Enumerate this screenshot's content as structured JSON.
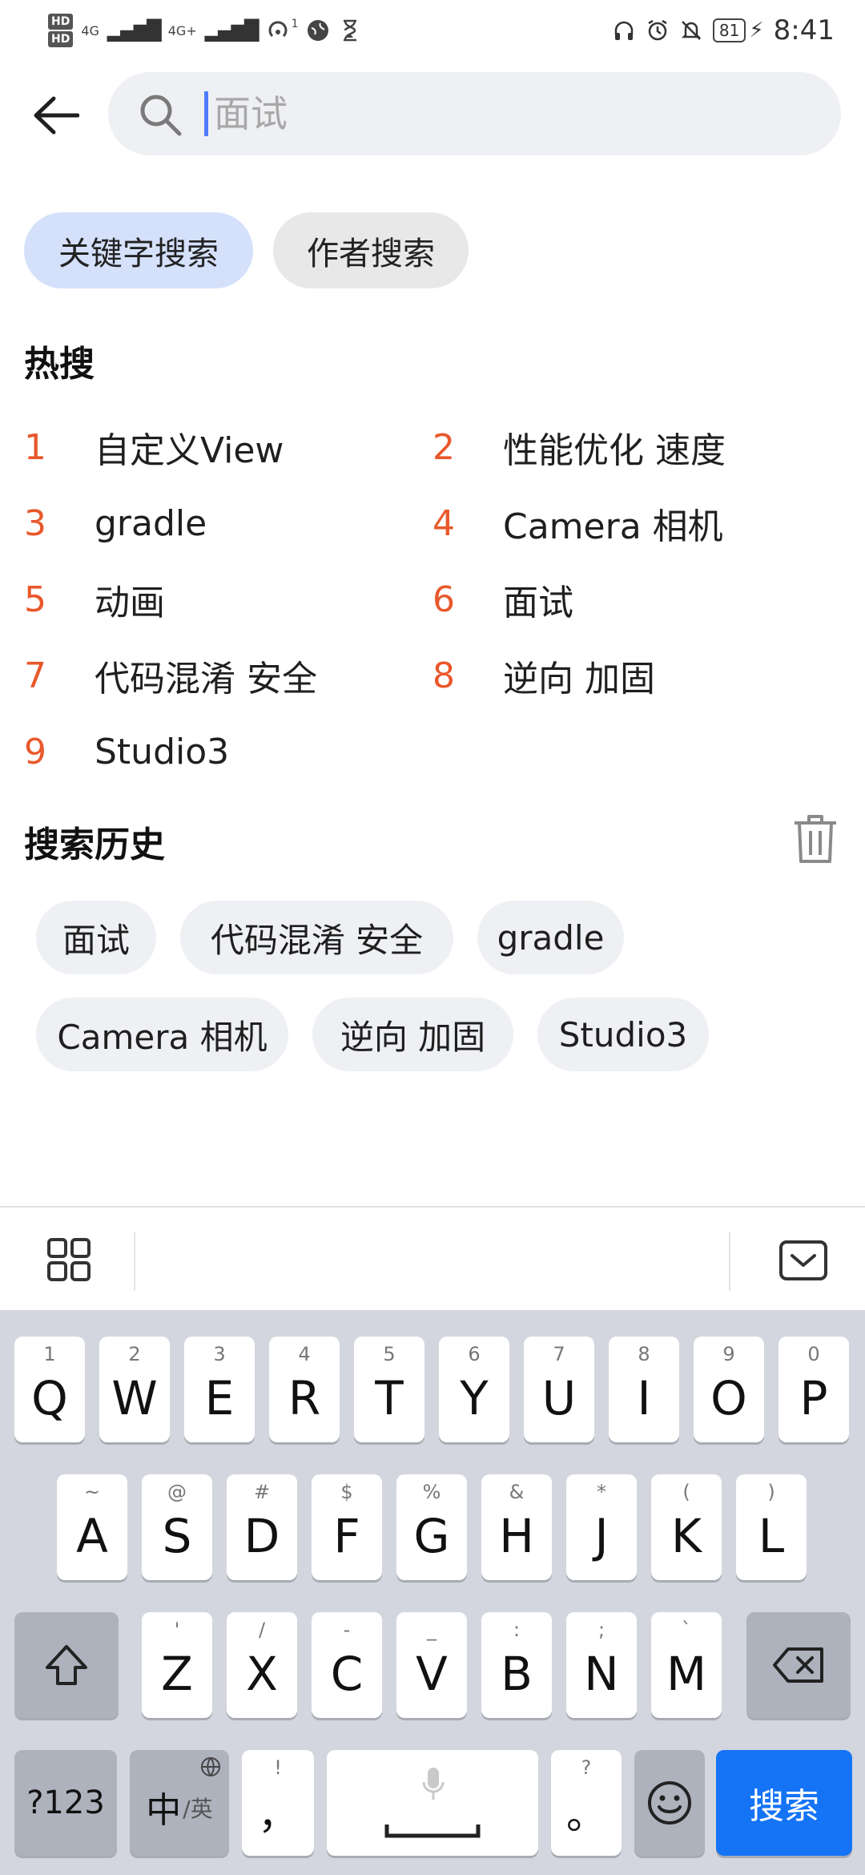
{
  "status_bar": {
    "left": {
      "hd1": "HD",
      "hd2": "HD",
      "net1": "4G",
      "net2": "4G+",
      "sup": "1"
    },
    "battery": "81",
    "time": "8:41"
  },
  "search": {
    "placeholder": "面试",
    "caret_color": "#4f7cff"
  },
  "tabs": [
    {
      "label": "关键字搜索",
      "active": true
    },
    {
      "label": "作者搜索",
      "active": false
    }
  ],
  "hot": {
    "title": "热搜",
    "items": [
      {
        "num": "1",
        "text": "自定义View"
      },
      {
        "num": "2",
        "text": "性能优化 速度"
      },
      {
        "num": "3",
        "text": "gradle"
      },
      {
        "num": "4",
        "text": "Camera 相机"
      },
      {
        "num": "5",
        "text": "动画"
      },
      {
        "num": "6",
        "text": "面试"
      },
      {
        "num": "7",
        "text": "代码混淆 安全"
      },
      {
        "num": "8",
        "text": "逆向 加固"
      },
      {
        "num": "9",
        "text": "Studio3"
      }
    ]
  },
  "history": {
    "title": "搜索历史",
    "chips": [
      "面试",
      "代码混淆 安全",
      "gradle",
      "Camera 相机",
      "逆向 加固",
      "Studio3"
    ]
  },
  "keyboard": {
    "row1": [
      {
        "hint": "1",
        "key": "Q"
      },
      {
        "hint": "2",
        "key": "W"
      },
      {
        "hint": "3",
        "key": "E"
      },
      {
        "hint": "4",
        "key": "R"
      },
      {
        "hint": "5",
        "key": "T"
      },
      {
        "hint": "6",
        "key": "Y"
      },
      {
        "hint": "7",
        "key": "U"
      },
      {
        "hint": "8",
        "key": "I"
      },
      {
        "hint": "9",
        "key": "O"
      },
      {
        "hint": "0",
        "key": "P"
      }
    ],
    "row2": [
      {
        "hint": "~",
        "key": "A"
      },
      {
        "hint": "@",
        "key": "S"
      },
      {
        "hint": "#",
        "key": "D"
      },
      {
        "hint": "$",
        "key": "F"
      },
      {
        "hint": "%",
        "key": "G"
      },
      {
        "hint": "&",
        "key": "H"
      },
      {
        "hint": "*",
        "key": "J"
      },
      {
        "hint": "(",
        "key": "K"
      },
      {
        "hint": ")",
        "key": "L"
      }
    ],
    "row3": [
      {
        "hint": "'",
        "key": "Z"
      },
      {
        "hint": "/",
        "key": "X"
      },
      {
        "hint": "-",
        "key": "C"
      },
      {
        "hint": "_",
        "key": "V"
      },
      {
        "hint": ":",
        "key": "B"
      },
      {
        "hint": ";",
        "key": "N"
      },
      {
        "hint": "`",
        "key": "M"
      }
    ],
    "num_switch": "?123",
    "lang_main": "中",
    "lang_sub": "/英",
    "comma_hint": "!",
    "comma": "，",
    "period_hint": "?",
    "period": "。",
    "search_label": "搜索",
    "accent": "#1574f6"
  },
  "colors": {
    "hot_number": "#e9582c",
    "tab_active_bg": "#d5e1fb",
    "chip_bg": "#eef0f3"
  }
}
